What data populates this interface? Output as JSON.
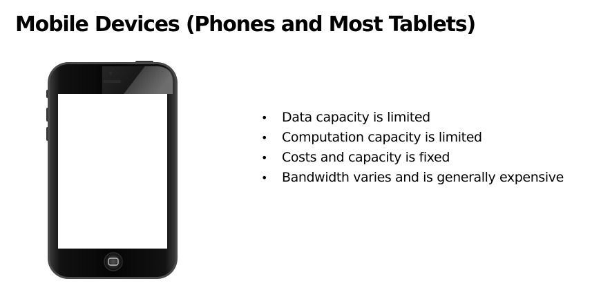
{
  "slide": {
    "title": "Mobile Devices (Phones and Most Tablets)",
    "bullets": [
      "Data capacity is limited",
      "Computation capacity is limited",
      "Costs and capacity is fixed",
      "Bandwidth varies and is generally expensive"
    ],
    "bullet_glyph": "•"
  },
  "illustration": {
    "subject": "smartphone-icon",
    "body_color": "#111111",
    "screen_color": "#ffffff"
  }
}
